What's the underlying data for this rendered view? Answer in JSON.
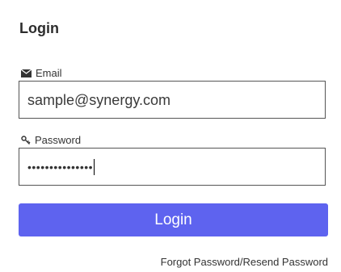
{
  "title": "Login",
  "email": {
    "label": "Email",
    "icon": "envelope-icon",
    "value": "sample@synergy.com"
  },
  "password": {
    "label": "Password",
    "icon": "key-icon",
    "value": "•••••••••••••••"
  },
  "login_button": {
    "label": "Login"
  },
  "forgot_link": {
    "label": "Forgot Password/Resend Password"
  },
  "colors": {
    "accent": "#5e63ef"
  }
}
